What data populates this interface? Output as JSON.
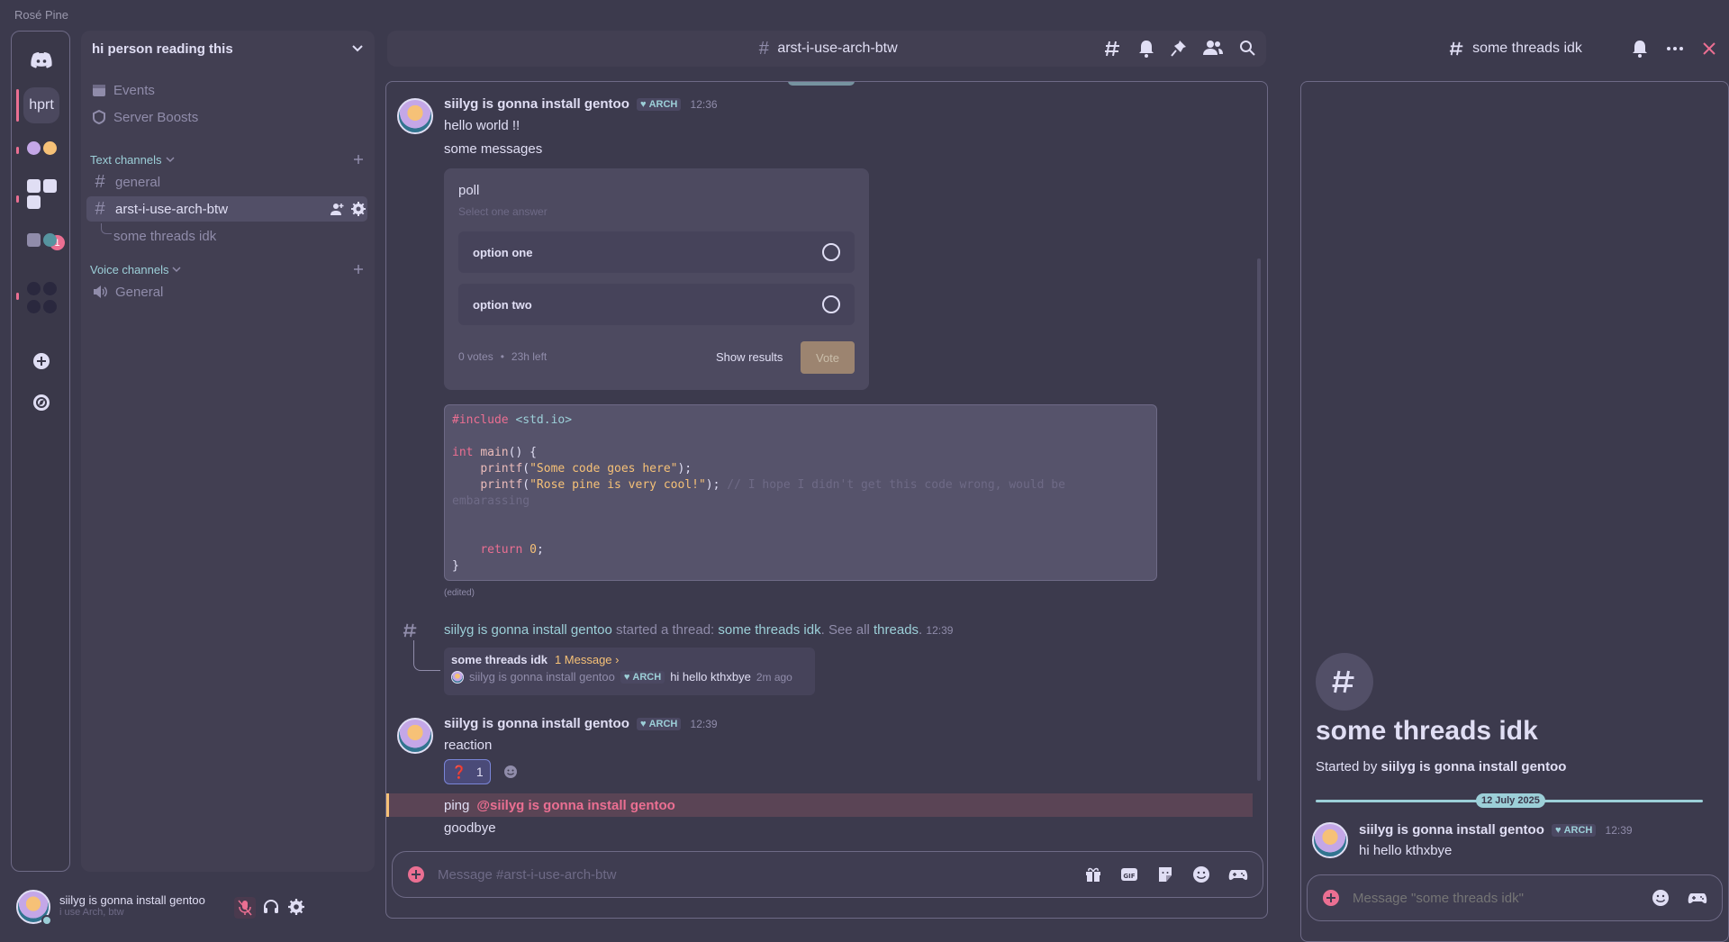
{
  "app": {
    "title": "Rosé Pine"
  },
  "rail": {
    "server_label": "hprt",
    "badge_count": "1"
  },
  "sidebar": {
    "server_name": "hi person reading this",
    "events_label": "Events",
    "boosts_label": "Server Boosts",
    "text_category": "Text channels",
    "voice_category": "Voice channels",
    "channels": [
      {
        "name": "general"
      },
      {
        "name": "arst-i-use-arch-btw"
      }
    ],
    "thread_name": "some threads idk",
    "voice_channels": [
      {
        "name": "General"
      }
    ]
  },
  "user": {
    "name": "siilyg is gonna install gentoo",
    "status": "i use Arch, btw"
  },
  "chat": {
    "channel_name": "arst-i-use-arch-btw",
    "author": "siilyg is gonna install gentoo",
    "tag": "ARCH",
    "messages": [
      {
        "time": "12:36",
        "lines": [
          "hello world !!",
          "some messages"
        ]
      },
      {
        "time": "12:39",
        "text": "reaction"
      }
    ],
    "poll": {
      "question": "poll",
      "hint": "Select one answer",
      "options": [
        "option one",
        "option two"
      ],
      "votes": "0 votes",
      "time_left": "23h left",
      "show_results": "Show results",
      "vote_button": "Vote"
    },
    "code_lines": [
      "#include <std.io>",
      "",
      "int main() {",
      "    printf(\"Some code goes here\");",
      "    printf(\"Rose pine is very cool!\"); // I hope I didn't get this code wrong, would be",
      "embarassing",
      "",
      "",
      "    return 0;",
      "}"
    ],
    "edited_label": "(edited)",
    "thread_started": {
      "author": "siilyg is gonna install gentoo",
      "text": "started a thread:",
      "thread_name": "some threads idk",
      "see_all": "See all",
      "threads_link": "threads",
      "time": "12:39"
    },
    "thread_card": {
      "name": "some threads idk",
      "count": "1 Message ›",
      "author": "siilyg is gonna install gentoo",
      "tag": "ARCH",
      "preview": "hi hello kthxbye",
      "ago": "2m ago"
    },
    "reaction": {
      "emoji": "❓",
      "count": "1"
    },
    "ping": {
      "text": "ping",
      "mention": "@siilyg is gonna install gentoo"
    },
    "goodbye": "goodbye",
    "composer_placeholder": "Message #arst-i-use-arch-btw"
  },
  "thread_panel": {
    "title": "some threads idk",
    "heading": "some threads idk",
    "started_by_label": "Started by",
    "started_by": "siilyg is gonna install gentoo",
    "date": "12 July 2025",
    "message": {
      "author": "siilyg is gonna install gentoo",
      "tag": "ARCH",
      "time": "12:39",
      "text": "hi hello kthxbye"
    },
    "composer_placeholder": "Message \"some threads idk\""
  },
  "colors": {
    "background": "#3c3a4d",
    "panel": "#423f52",
    "love": "#eb6f92",
    "gold": "#f6c177",
    "foam": "#9ccfd8",
    "iris": "#c4a7e7",
    "muted": "#908caa"
  },
  "icons": [
    "discord-icon",
    "add-server-icon",
    "explore-icon",
    "calendar-icon",
    "shield-icon",
    "chevron-down-icon",
    "plus-icon",
    "hash-icon",
    "speaker-icon",
    "threads-icon",
    "bell-icon",
    "pin-icon",
    "members-icon",
    "search-icon",
    "gift-icon",
    "gif-icon",
    "sticker-icon",
    "emoji-icon",
    "game-icon",
    "mic-muted-icon",
    "headphones-icon",
    "gear-icon",
    "close-icon",
    "more-icon",
    "add-user-icon"
  ]
}
